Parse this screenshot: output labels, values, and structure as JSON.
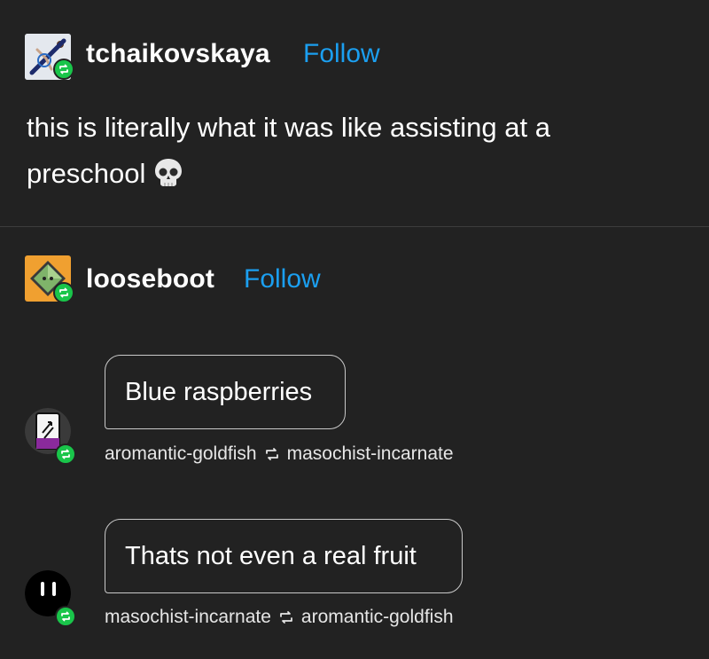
{
  "post1": {
    "username": "tchaikovskaya",
    "follow_label": "Follow",
    "text": "this is literally what it was like assisting at a preschool",
    "emoji": "skull-emoji"
  },
  "post2": {
    "username": "looseboot",
    "follow_label": "Follow"
  },
  "chat": [
    {
      "message": "Blue raspberries",
      "from": "aromantic-goldfish",
      "to": "masochist-incarnate"
    },
    {
      "message": "Thats not even a real fruit",
      "from": "masochist-incarnate",
      "to": "aromantic-goldfish"
    }
  ],
  "colors": {
    "background": "#222222",
    "follow": "#1b9ff0",
    "reblog_badge": "#19c54a"
  },
  "icons": [
    "reblog-icon",
    "skull-emoji",
    "avatar-gymnast",
    "avatar-orange-diamond",
    "avatar-uno-reverse",
    "avatar-smiley"
  ]
}
